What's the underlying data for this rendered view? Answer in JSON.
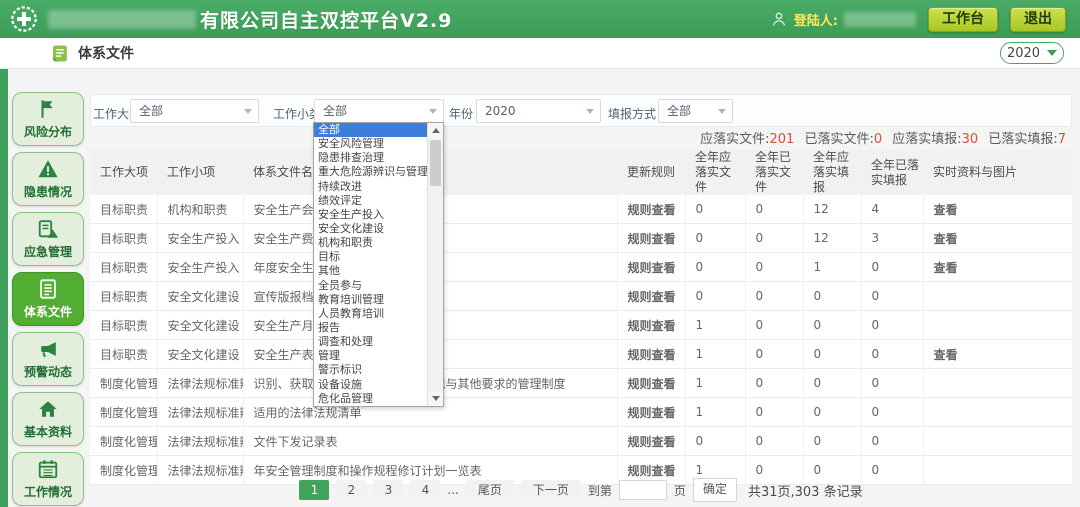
{
  "header": {
    "title_suffix": "有限公司自主双控平台V2.9",
    "login_label": "登陆人:",
    "workbench_button": "工作台",
    "logout_button": "退出"
  },
  "breadcrumb": {
    "title": "体系文件",
    "year_selector": "2020"
  },
  "sidebar": {
    "items": [
      {
        "label": "风险分布",
        "icon": "flag-icon",
        "active": false
      },
      {
        "label": "隐患情况",
        "icon": "warning-icon",
        "active": false
      },
      {
        "label": "应急管理",
        "icon": "emergency-doc-icon",
        "active": false
      },
      {
        "label": "体系文件",
        "icon": "document-icon",
        "active": true
      },
      {
        "label": "预警动态",
        "icon": "megaphone-icon",
        "active": false
      },
      {
        "label": "基本资料",
        "icon": "home-icon",
        "active": false
      },
      {
        "label": "工作情况",
        "icon": "calendar-icon",
        "active": false
      }
    ]
  },
  "filters": [
    {
      "label": "工作大类",
      "value": "全部"
    },
    {
      "label": "工作小类",
      "value": "全部"
    },
    {
      "label": "年份",
      "value": "2020"
    },
    {
      "label": "填报方式",
      "value": "全部"
    }
  ],
  "dropdown": {
    "selected_index": 0,
    "options": [
      "全部",
      "安全风险管理",
      "隐患排查治理",
      "重大危险源辨识与管理",
      "持续改进",
      "绩效评定",
      "安全生产投入",
      "安全文化建设",
      "机构和职责",
      "目标",
      "其他",
      "全员参与",
      "教育培训管理",
      "人员教育培训",
      "报告",
      "调查和处理",
      "管理",
      "警示标识",
      "设备设施",
      "危化品管理"
    ]
  },
  "stats": [
    {
      "label": "应落实文件:",
      "value": "201"
    },
    {
      "label": "已落实文件:",
      "value": "0"
    },
    {
      "label": "应落实填报:",
      "value": "30"
    },
    {
      "label": "已落实填报:",
      "value": "7"
    }
  ],
  "table": {
    "columns": [
      "工作大项",
      "工作小项",
      "体系文件名称",
      "更新规则",
      "全年应落实文件",
      "全年已落实文件",
      "全年应落实填报",
      "全年已落实填报",
      "实时资料与图片"
    ],
    "rule_link_label": "规则查看",
    "view_link_label": "查看",
    "rows": [
      [
        "目标职责",
        "机构和职责",
        "安全生产会议记录",
        "规则查看",
        "0",
        "0",
        "12",
        "4",
        "查看"
      ],
      [
        "目标职责",
        "安全生产投入",
        "安全生产费用使用台账",
        "规则查看",
        "0",
        "0",
        "12",
        "3",
        "查看"
      ],
      [
        "目标职责",
        "安全生产投入",
        "年度安全生产费用计划",
        "规则查看",
        "0",
        "0",
        "1",
        "0",
        "查看"
      ],
      [
        "目标职责",
        "安全文化建设",
        "宣传版报档案",
        "规则查看",
        "0",
        "0",
        "0",
        "0",
        ""
      ],
      [
        "目标职责",
        "安全文化建设",
        "安全生产月活动记录",
        "规则查看",
        "1",
        "0",
        "0",
        "0",
        ""
      ],
      [
        "目标职责",
        "安全文化建设",
        "安全生产表彰记录",
        "规则查看",
        "1",
        "0",
        "0",
        "0",
        "查看"
      ],
      [
        "制度化管理",
        "法律法规标准辨识",
        "识别、获取、评审安全生产法律法规与其他要求的管理制度",
        "规则查看",
        "1",
        "0",
        "0",
        "0",
        ""
      ],
      [
        "制度化管理",
        "法律法规标准辨识",
        "适用的法律法规清单",
        "规则查看",
        "1",
        "0",
        "0",
        "0",
        ""
      ],
      [
        "制度化管理",
        "法律法规标准辨识",
        "文件下发记录表",
        "规则查看",
        "0",
        "0",
        "0",
        "0",
        ""
      ],
      [
        "制度化管理",
        "法律法规标准辨识",
        "年安全管理制度和操作规程修订计划一览表",
        "规则查看",
        "1",
        "0",
        "0",
        "0",
        ""
      ]
    ]
  },
  "pagination": {
    "pages": [
      "1",
      "2",
      "3",
      "4"
    ],
    "active_page": "1",
    "ellipsis": "...",
    "last_label": "尾页",
    "next_label": "下一页",
    "goto_prefix": "到第",
    "goto_value": "",
    "goto_suffix": "页",
    "confirm_label": "确定",
    "summary": "共31页,303 条记录"
  },
  "colors": {
    "header_green": "#3fa15c",
    "active_nav_green": "#52ae32",
    "link_green": "#3fa351",
    "button_yellow_green": "#b4cf35",
    "login_label_yellow": "#ffe95a",
    "stat_number_red": "#d8503c",
    "dropdown_selected_blue": "#3d7edb"
  }
}
